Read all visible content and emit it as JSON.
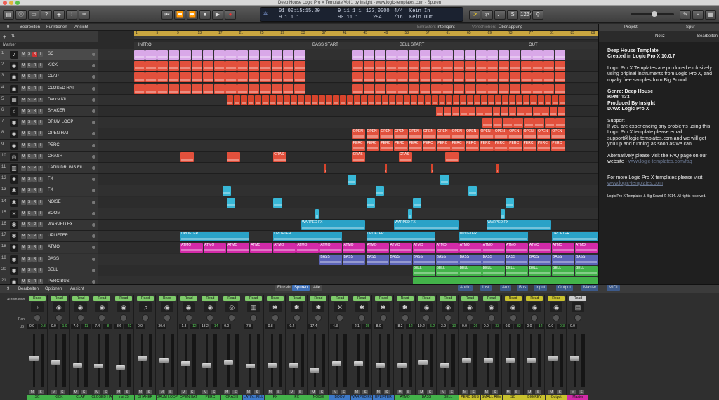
{
  "window": {
    "title": "Deep House Logic Pro X Template Vol.1 by Insight - www.logic-templates.com - Spuren"
  },
  "toolbar": {
    "lcd": {
      "time": "01:00:15:15.20",
      "bars": "9 1 1 1",
      "bars2": "9 11 1 1",
      "bars3": "9 11 1 1",
      "pos2": "90 11 1",
      "val1": "123,0000",
      "val2": "294",
      "sig1": "4/4",
      "sig2": "/16",
      "in": "Kein In",
      "out": "Kein Out"
    }
  },
  "subbar": {
    "num": "9",
    "edit": "Bearbeiten",
    "func": "Funktionen",
    "view": "Ansicht",
    "snap": "Einrasten:",
    "snapval": "Intelligent",
    "move": "Verschieben:",
    "moveval": "Überlappung"
  },
  "ruler": [
    "1",
    "5",
    "9",
    "13",
    "17",
    "21",
    "25",
    "29",
    "33",
    "37",
    "41",
    "45",
    "49",
    "53",
    "57",
    "61",
    "65",
    "69",
    "73",
    "77",
    "81",
    "85",
    "89"
  ],
  "markers": {
    "label": "Marker",
    "items": [
      {
        "t": "INTRO"
      },
      {
        "t": "BASS START"
      },
      {
        "t": "BELL START"
      },
      {
        "t": "OUT"
      }
    ]
  },
  "tracks": [
    {
      "n": "1",
      "name": "SC",
      "icon": "♪",
      "color": "#d9a8e8"
    },
    {
      "n": "2",
      "name": "KICK",
      "icon": "◉",
      "color": "#e2503c"
    },
    {
      "n": "3",
      "name": "CLAP",
      "icon": "◉",
      "color": "#e2503c"
    },
    {
      "n": "4",
      "name": "CLOSED HAT",
      "icon": "◉",
      "color": "#e2503c"
    },
    {
      "n": "5",
      "name": "Dance Kit",
      "icon": "▦",
      "color": "#d8442c"
    },
    {
      "n": "6",
      "name": "SHAKER",
      "icon": "♫",
      "color": "#e2503c"
    },
    {
      "n": "7",
      "name": "DRUM LOOP",
      "icon": "◉",
      "color": "#e2503c"
    },
    {
      "n": "8",
      "name": "OPEN HAT",
      "icon": "◉",
      "color": "#e2503c"
    },
    {
      "n": "9",
      "name": "PERC",
      "icon": "◉",
      "color": "#e2503c"
    },
    {
      "n": "10",
      "name": "CRASH",
      "icon": "◎",
      "color": "#e2503c"
    },
    {
      "n": "11",
      "name": "LATIN DRUMS FILL",
      "icon": "▥",
      "color": "#d8442c"
    },
    {
      "n": "12",
      "name": "FX",
      "icon": "✱",
      "color": "#38b7d6"
    },
    {
      "n": "13",
      "name": "FX",
      "icon": "✱",
      "color": "#38b7d6"
    },
    {
      "n": "14",
      "name": "NOISE",
      "icon": "✱",
      "color": "#38b7d6"
    },
    {
      "n": "15",
      "name": "BOOM",
      "icon": "✕",
      "color": "#38b7d6"
    },
    {
      "n": "16",
      "name": "WARPED FX",
      "icon": "✱",
      "color": "#2aa2c7"
    },
    {
      "n": "17",
      "name": "UPLIFTER",
      "icon": "✱",
      "color": "#2aa2c7"
    },
    {
      "n": "18",
      "name": "ATMO",
      "icon": "✱",
      "color": "#d22aa8"
    },
    {
      "n": "19",
      "name": "BASS",
      "icon": "◉",
      "color": "#5c64b8"
    },
    {
      "n": "20",
      "name": "BELL",
      "icon": "◉",
      "color": "#43b34a"
    },
    {
      "n": "21",
      "name": "PERC BUS",
      "icon": "◉",
      "color": "#43b34a"
    }
  ],
  "inspector": {
    "tab1": "Projekt",
    "tab2": "Spur",
    "sub1": "Notiz",
    "sub2": "Bearbeiten",
    "p1a": "Deep House Template",
    "p1b": "Created in Logic Pro X 10.0.7",
    "p2": "Logic Pro X Templates are produced exclusively using original instruments from Logic Pro X, and royalty free samples from Big Sound.",
    "g1": "Genre: Deep House",
    "g2": "BPM: 123",
    "g3": "Produced By Insight",
    "g4": "DAW: Logic Pro X",
    "s1": "Support",
    "s2": "If you are experiencing any problems using this Logic Pro X template please email support@logic-templates.com and we will get you up and running as soon as we can.",
    "a1": "Alternatively please visit the FAQ page on our website - ",
    "a2": "www.logic-templates.com/faq",
    "m1": "For more Logic Pro X templates please visit ",
    "m2": "www.logic-templates.com",
    "c": "Logic Pro X Templates & Big Sound © 2014. All rights reserved."
  },
  "mixer": {
    "num": "9",
    "edit": "Bearbeiten",
    "opt": "Optionen",
    "view": "Ansicht",
    "single": "Einzeln",
    "tracks": "Spuren",
    "all": "Alle",
    "cats": [
      "Audio",
      "Inst",
      "Aux",
      "Bus",
      "Input",
      "Output",
      "Master",
      "MIDI"
    ],
    "automation": "Automation",
    "pan": "Pan",
    "db": "dB",
    "strips": [
      {
        "name": "SC",
        "num": "1",
        "read": "Read",
        "db": "0.0",
        "pk": "-0.3",
        "color": "#43b34a",
        "icon": "♪",
        "f": 0.45
      },
      {
        "name": "KICK",
        "num": "2",
        "read": "Read",
        "db": "0.0",
        "pk": "-1.9",
        "color": "#43b34a",
        "icon": "◉",
        "f": 0.55
      },
      {
        "name": "CLAP",
        "num": "3",
        "read": "Read",
        "db": "-7.0",
        "pk": "-11",
        "color": "#43b34a",
        "icon": "◉",
        "f": 0.6
      },
      {
        "name": "CLOSED HAT",
        "num": "4",
        "read": "Read",
        "db": "-7.4",
        "pk": "-8",
        "color": "#43b34a",
        "icon": "◉",
        "f": 0.62
      },
      {
        "name": "Inst 25",
        "num": "5",
        "read": "Read",
        "db": "-8.6",
        "pk": "-22",
        "color": "#43b34a",
        "icon": "◉",
        "f": 0.65
      },
      {
        "name": "SHAKER",
        "num": "6",
        "read": "Read",
        "db": "0.0",
        "pk": "",
        "color": "#43b34a",
        "icon": "♫",
        "f": 0.45
      },
      {
        "name": "DRUM LOOP",
        "num": "7",
        "read": "Read",
        "db": "30.0",
        "pk": "",
        "color": "#43b34a",
        "icon": "◉",
        "f": 0.5
      },
      {
        "name": "OPEN HAT",
        "num": "8",
        "read": "Read",
        "db": "-1.8",
        "pk": "-12",
        "color": "#43b34a",
        "icon": "◉",
        "f": 0.58
      },
      {
        "name": "PERC",
        "num": "9",
        "read": "Read",
        "db": "13.2",
        "pk": "-14",
        "color": "#43b34a",
        "icon": "◉",
        "f": 0.6
      },
      {
        "name": "CRASH",
        "num": "10",
        "read": "Read",
        "db": "0.0",
        "pk": "",
        "color": "#43b34a",
        "icon": "◎",
        "f": 0.55
      },
      {
        "name": "LATIN...FILL",
        "num": "11",
        "read": "Read",
        "db": "-7.8",
        "pk": "",
        "color": "#3d79c8",
        "icon": "▥",
        "f": 0.62
      },
      {
        "name": "FX",
        "num": "12",
        "read": "Read",
        "db": "-0.8",
        "pk": "",
        "color": "#43b34a",
        "icon": "✱",
        "f": 0.6
      },
      {
        "name": "FX",
        "num": "13",
        "read": "Read",
        "db": "-0.2",
        "pk": "",
        "color": "#43b34a",
        "icon": "✱",
        "f": 0.6
      },
      {
        "name": "NOISE",
        "num": "14",
        "read": "Read",
        "db": "-17.4",
        "pk": "",
        "color": "#43b34a",
        "icon": "✱",
        "f": 0.7
      },
      {
        "name": "BOOM",
        "num": "15",
        "read": "Read",
        "db": "-4.3",
        "pk": "",
        "color": "#3d79c8",
        "icon": "✕",
        "f": 0.58
      },
      {
        "name": "WARPED FX",
        "num": "16",
        "read": "Read",
        "db": "-2.1",
        "pk": "-15",
        "color": "#3d79c8",
        "icon": "✱",
        "f": 0.58
      },
      {
        "name": "UPLIFTER",
        "num": "17",
        "read": "Read",
        "db": "-8.0",
        "pk": "",
        "color": "#3d79c8",
        "icon": "✱",
        "f": 0.6
      },
      {
        "name": "ATMO",
        "num": "18",
        "read": "Read",
        "db": "-8.2",
        "pk": "-12",
        "color": "#43b34a",
        "icon": "✱",
        "f": 0.6
      },
      {
        "name": "BASS",
        "num": "19",
        "read": "Read",
        "db": "10.2",
        "pk": "-5.2",
        "color": "#43b34a",
        "icon": "◉",
        "f": 0.55
      },
      {
        "name": "BELL",
        "num": "20",
        "read": "Read",
        "db": "-3.9",
        "pk": "-10",
        "color": "#43b34a",
        "icon": "◉",
        "f": 0.6
      },
      {
        "name": "PERC BUS",
        "num": "21",
        "read": "Read",
        "db": "0.0",
        "pk": "-26",
        "color": "#c9c22e",
        "icon": "◉",
        "f": 0.5
      },
      {
        "name": "SMALL REV",
        "num": "22",
        "read": "Read",
        "db": "0.0",
        "pk": "-33",
        "color": "#c9c22e",
        "icon": "◉",
        "f": 0.5
      },
      {
        "name": "SC",
        "num": "",
        "read": "Read",
        "db": "0.0",
        "pk": "-32",
        "color": "#c9c22e",
        "icon": "◉",
        "f": 0.5
      },
      {
        "name": "BIG REV",
        "num": "",
        "read": "Read",
        "db": "0.0",
        "pk": "-12",
        "color": "#c9c22e",
        "icon": "◉",
        "f": 0.5
      },
      {
        "name": "Output",
        "num": "",
        "read": "Read",
        "db": "0.0",
        "pk": "-0.3",
        "color": "#c9c22e",
        "icon": "◉",
        "f": 0.45
      },
      {
        "name": "Master",
        "num": "",
        "read": "Read",
        "db": "0.0",
        "pk": "",
        "color": "#d22aa8",
        "icon": "▤",
        "f": 0.45
      }
    ]
  }
}
